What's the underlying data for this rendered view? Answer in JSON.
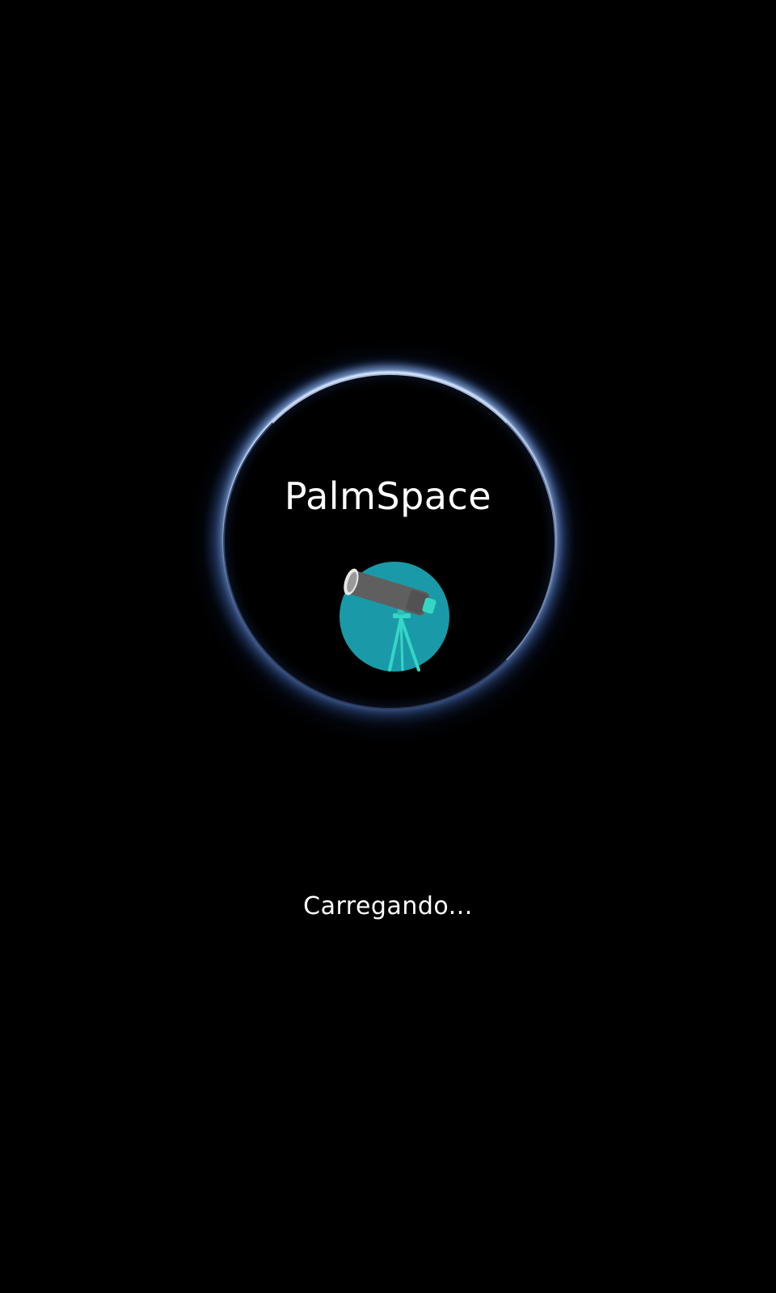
{
  "app": {
    "title": "PalmSpace",
    "logo_icon": "telescope-icon"
  },
  "status": {
    "loading_text": "Carregando..."
  },
  "colors": {
    "background": "#000000",
    "logo_circle": "#1a9aa8",
    "telescope_body": "#5f5f5f",
    "telescope_accent": "#35d6c6",
    "text": "#ffffff",
    "ring_glow": "#9fbaf0"
  }
}
